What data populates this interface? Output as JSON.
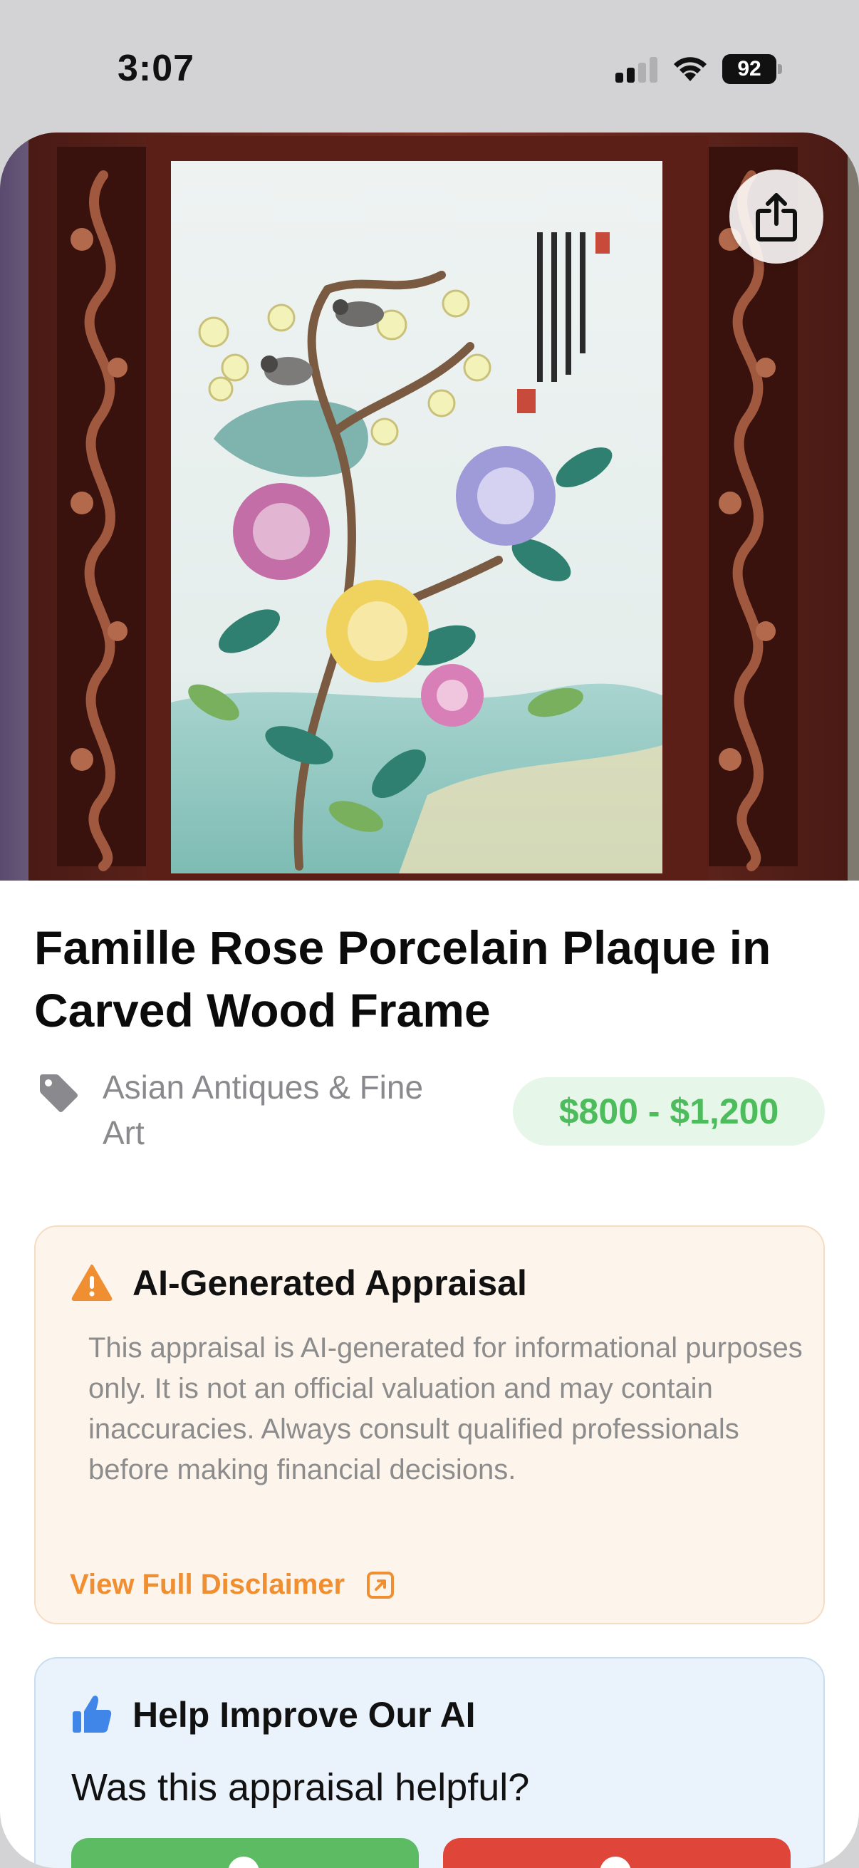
{
  "status_bar": {
    "time": "3:07",
    "battery_level": "92"
  },
  "item": {
    "title": "Famille Rose Porcelain Plaque in Carved Wood Frame",
    "category": "Asian Antiques & Fine Art",
    "price_range": "$800 - $1,200"
  },
  "disclaimer": {
    "heading": "AI-Generated Appraisal",
    "body": "This appraisal is AI-generated for informational purposes only. It is not an official valuation and may contain inaccuracies. Always consult qualified professionals before making financial decisions.",
    "link_label": "View Full Disclaimer"
  },
  "feedback": {
    "heading": "Help Improve Our AI",
    "question": "Was this appraisal helpful?"
  },
  "icons": {
    "share": "share-icon",
    "tag": "tag-icon",
    "warning": "warning-icon",
    "external_link": "external-link-icon",
    "thumbs_up": "thumbs-up-icon"
  },
  "colors": {
    "price_text": "#4cbc5c",
    "price_bg": "#e6f6e8",
    "warning_accent": "#ef8f32",
    "disclaimer_bg": "#fdf4ec",
    "feedback_bg": "#eaf2fb",
    "yes_button": "#5dbb63",
    "no_button": "#e0453a",
    "thumb_blue": "#3f86e8"
  }
}
